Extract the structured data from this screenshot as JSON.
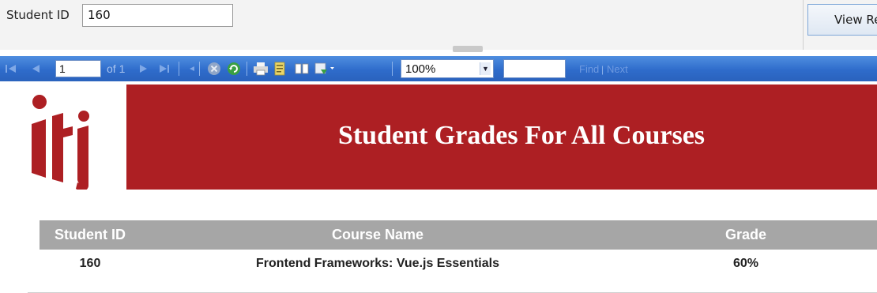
{
  "parameters": {
    "student_id_label": "Student ID",
    "student_id_value": "160",
    "view_report_label": "View Re"
  },
  "toolbar": {
    "page_number": "1",
    "of_text": "of 1",
    "zoom_value": "100%",
    "find_label": "Find",
    "find_separator": "|",
    "next_label": "Next",
    "icons": [
      "first-page",
      "previous-page",
      "next-page",
      "last-page",
      "back",
      "stop",
      "refresh",
      "print",
      "print-layout",
      "page-setup",
      "export",
      "zoom-dropdown"
    ]
  },
  "report": {
    "title": "Student Grades For All Courses",
    "brand_color": "#ad1f23",
    "table": {
      "headers": [
        "Student ID",
        "Course Name",
        "Grade"
      ],
      "rows": [
        [
          "160",
          "Frontend Frameworks: Vue.js Essentials",
          "60%"
        ]
      ]
    }
  }
}
